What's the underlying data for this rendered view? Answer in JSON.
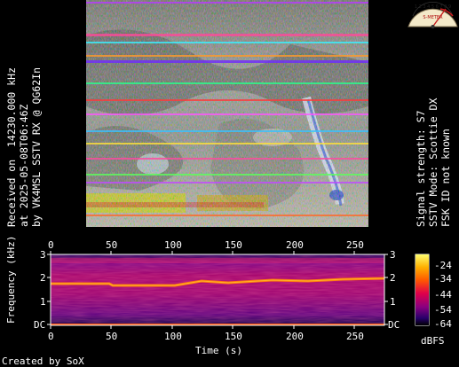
{
  "left_caption": {
    "line1": "Received on  14230.000 kHz",
    "line2": "at 2025-05-08T06:46Z",
    "line3": "by VK4MSL SSTV RX @ QG62In"
  },
  "right_caption": {
    "line1": "Signal strength: S7",
    "line2": "SSTV Mode: Scottie DX",
    "line3": "FSK ID not known"
  },
  "smeter": {
    "scale_text": "1 2 3 4 5 6 7 8 9",
    "label": "S-METER",
    "reading": "S7"
  },
  "spectrogram": {
    "xlabel": "Time (s)",
    "ylabel": "Frequency (kHz)",
    "x_ticks": [
      "0",
      "50",
      "100",
      "150",
      "200",
      "250"
    ],
    "y_ticks": [
      "3",
      "2",
      "1",
      "DC"
    ],
    "colorbar_ticks": [
      "-24",
      "-34",
      "-44",
      "-54",
      "-64"
    ],
    "colorbar_unit": "dBFS"
  },
  "credit": "Created by SoX",
  "colors": {
    "background": "#000000",
    "text": "#ffffff",
    "tone_line": "#ff7a10"
  }
}
